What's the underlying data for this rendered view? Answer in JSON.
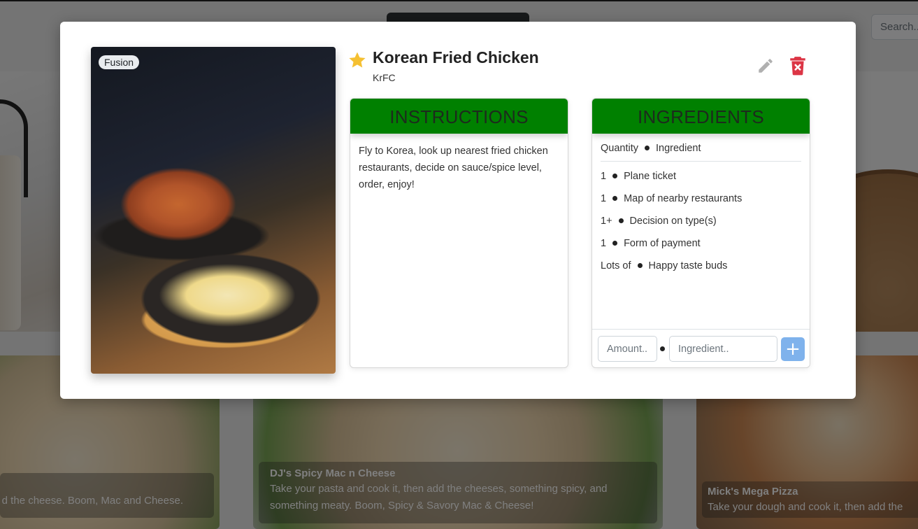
{
  "background": {
    "search_placeholder": "Search..",
    "cards": [
      {
        "title": "",
        "description": "d the cheese. Boom, Mac and Cheese."
      },
      {
        "title": "DJ's Spicy Mac n Cheese",
        "description": "Take your pasta and cook it, then add the cheeses, something spicy, and something meaty. Boom, Spicy & Savory Mac & Cheese!"
      },
      {
        "title": "Mick's Mega Pizza",
        "description": "Take your dough and cook it, then add the"
      }
    ]
  },
  "recipe": {
    "category_badge": "Fusion",
    "favorite": true,
    "title": "Korean Fried Chicken",
    "subtitle": "KrFC",
    "colors": {
      "panel_header": "#008000",
      "favorite_star": "#f5c032",
      "delete": "#dc3545",
      "edit": "#b0b0b0",
      "add_button": "#7fb2ec"
    },
    "instructions": {
      "heading": "INSTRUCTIONS",
      "text": "Fly to Korea, look up nearest fried chicken restaurants, decide on sauce/spice level, order, enjoy!"
    },
    "ingredients": {
      "heading": "INGREDIENTS",
      "header": {
        "quantity": "Quantity",
        "ingredient": "Ingredient"
      },
      "items": [
        {
          "quantity": "1",
          "name": "Plane ticket"
        },
        {
          "quantity": "1",
          "name": "Map of nearby restaurants"
        },
        {
          "quantity": "1+",
          "name": "Decision on type(s)"
        },
        {
          "quantity": "1",
          "name": "Form of payment"
        },
        {
          "quantity": "Lots of",
          "name": "Happy taste buds"
        }
      ],
      "form": {
        "amount_placeholder": "Amount..",
        "ingredient_placeholder": "Ingredient..",
        "add_label": "+"
      }
    },
    "icons": {
      "favorite": "star-icon",
      "edit": "pencil-icon",
      "delete": "trash-icon"
    }
  }
}
